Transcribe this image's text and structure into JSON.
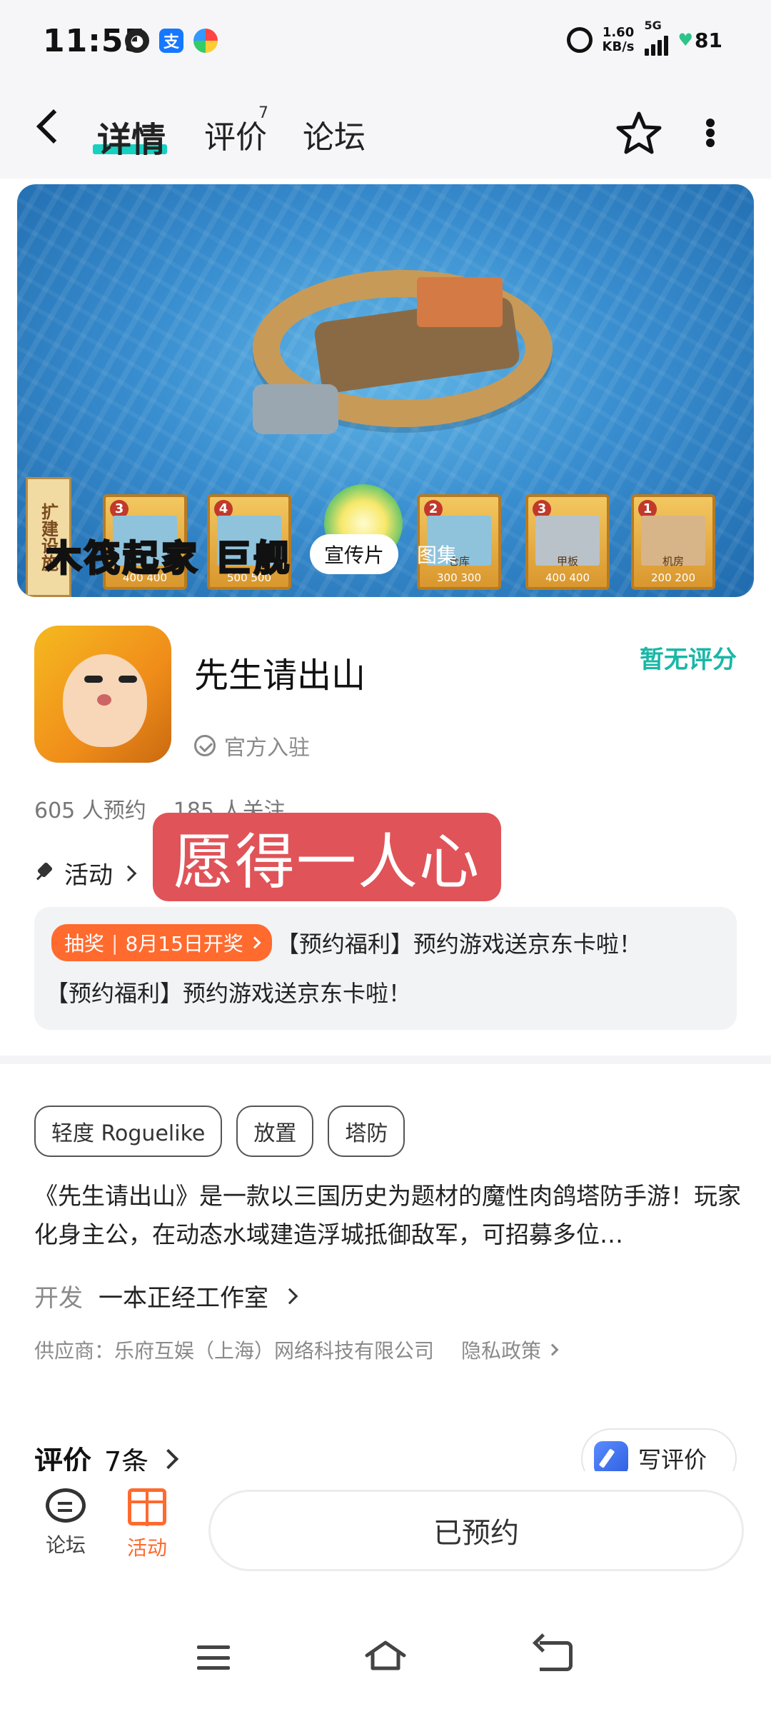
{
  "status_bar": {
    "time": "11:55",
    "net_speed_value": "1.60",
    "net_speed_unit": "KB/s",
    "network": "5G",
    "battery": "81"
  },
  "nav": {
    "tabs": [
      {
        "label": "详情"
      },
      {
        "label": "评价"
      },
      {
        "label": "论坛"
      }
    ],
    "review_badge": "7"
  },
  "hero": {
    "caption_red": "木",
    "caption": "筏起家 巨舰",
    "side_banner": "扩建设施",
    "media_tabs": [
      "宣传片",
      "图集"
    ],
    "cards": [
      {
        "num": "3",
        "cost": "400  400",
        "label": ""
      },
      {
        "num": "4",
        "cost": "500  500",
        "label": ""
      },
      {
        "num": "2",
        "cost": "300  300",
        "label": "仓库"
      },
      {
        "num": "3",
        "cost": "400  400",
        "label": "甲板"
      },
      {
        "num": "1",
        "cost": "200  200",
        "label": "机房"
      }
    ]
  },
  "app": {
    "name": "先生请出山",
    "rating_status": "暂无评分",
    "official": "官方入驻",
    "reservations": "605 人预约",
    "followers": "185 人关注"
  },
  "activity": {
    "label": "活动",
    "overlay_text": "愿得一人心",
    "lottery_tag": "抽奖",
    "lottery_date": "8月15日开奖",
    "promo_line1": "【预约福利】预约游戏送京东卡啦！",
    "promo_line2": "【预约福利】预约游戏送京东卡啦！"
  },
  "details": {
    "tags": [
      "轻度 Roguelike",
      "放置",
      "塔防"
    ],
    "description": "《先生请出山》是一款以三国历史为题材的魔性肉鸽塔防手游！玩家化身主公，在动态水域建造浮城抵御敌军，可招募多位…",
    "developer_label": "开发",
    "developer_name": "一本正经工作室",
    "supplier": "供应商：乐府互娱（上海）网络科技有限公司",
    "privacy": "隐私政策"
  },
  "reviews": {
    "title": "评价",
    "count": "7条",
    "write_label": "写评价"
  },
  "bottom_bar": {
    "forum_label": "论坛",
    "activity_label": "活动",
    "reserved_label": "已预约"
  },
  "colors": {
    "accent_teal": "#18d0c0",
    "rating_teal": "#19b7a7",
    "orange": "#ff6a2e",
    "overlay_red": "#e05358"
  }
}
